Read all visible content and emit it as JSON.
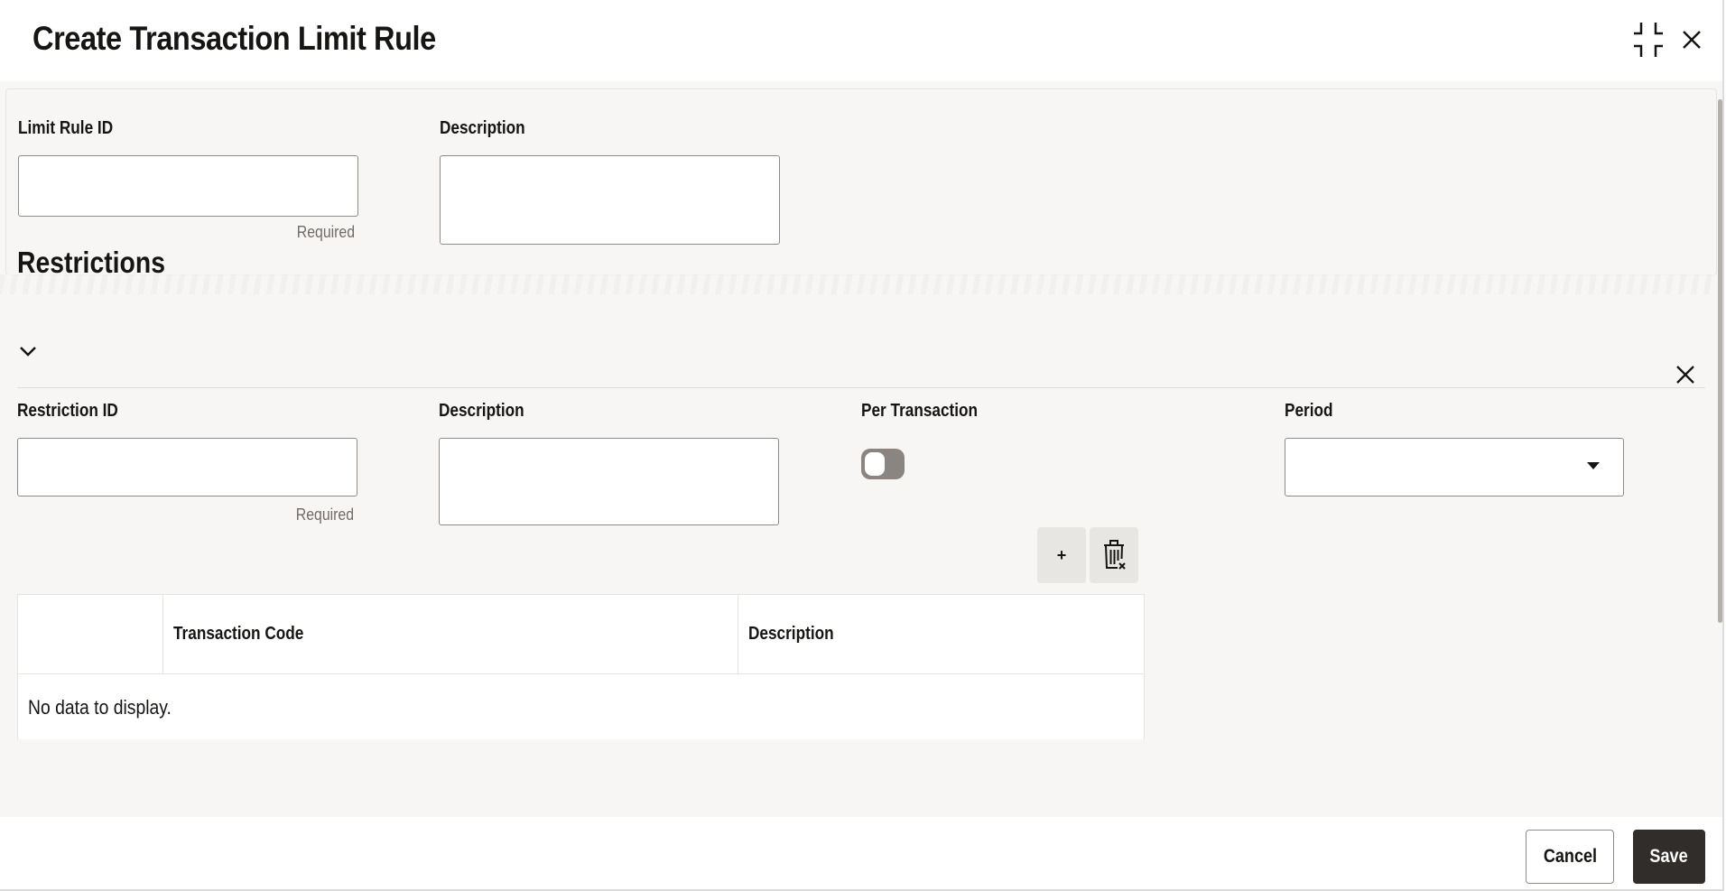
{
  "header": {
    "title": "Create Transaction Limit Rule",
    "icons": [
      "collapse-icon",
      "close-icon"
    ]
  },
  "rule_form": {
    "limit_rule_id": {
      "label": "Limit Rule ID",
      "value": "",
      "helper": "Required"
    },
    "description": {
      "label": "Description",
      "value": ""
    }
  },
  "restrictions": {
    "title": "Restrictions",
    "restriction_id": {
      "label": "Restriction ID",
      "value": "",
      "helper": "Required"
    },
    "description": {
      "label": "Description",
      "value": ""
    },
    "per_transaction": {
      "label": "Per Transaction",
      "checked": false
    },
    "period": {
      "label": "Period",
      "selected": ""
    },
    "add_label": "+",
    "table": {
      "columns": [
        "",
        "Transaction Code",
        "Description"
      ],
      "rows": [],
      "empty_text": "No data to display."
    }
  },
  "footer": {
    "cancel_label": "Cancel",
    "save_label": "Save"
  },
  "colors": {
    "primary_button": "#312d2a",
    "background": "#f7f6f4",
    "toggle_off": "#8a8580"
  }
}
